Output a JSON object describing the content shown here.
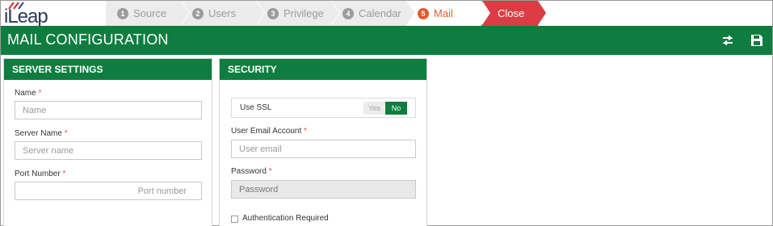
{
  "logo": {
    "text": "iLeap"
  },
  "wizard": {
    "steps": [
      {
        "num": "1",
        "label": "Source"
      },
      {
        "num": "2",
        "label": "Users"
      },
      {
        "num": "3",
        "label": "Privilege"
      },
      {
        "num": "4",
        "label": "Calendar"
      },
      {
        "num": "5",
        "label": "Mail"
      }
    ],
    "close_label": "Close"
  },
  "header": {
    "title": "MAIL CONFIGURATION"
  },
  "server": {
    "title": "SERVER SETTINGS",
    "name_label": "Name",
    "name_placeholder": "Name",
    "server_name_label": "Server Name",
    "server_name_placeholder": "Server name",
    "port_label": "Port Number",
    "port_placeholder": "Port number",
    "required_mark": "*"
  },
  "security": {
    "title": "SECURITY",
    "ssl_label": "Use SSL",
    "ssl_yes": "Yes",
    "ssl_no": "No",
    "email_label": "User Email Account",
    "email_placeholder": "User email",
    "password_label": "Password",
    "password_placeholder": "Password",
    "auth_label": "Authentication Required",
    "required_mark": "*"
  },
  "colors": {
    "brand_green": "#0f7d3f",
    "active_step": "#e35b2b",
    "close_red": "#dc3c44"
  }
}
